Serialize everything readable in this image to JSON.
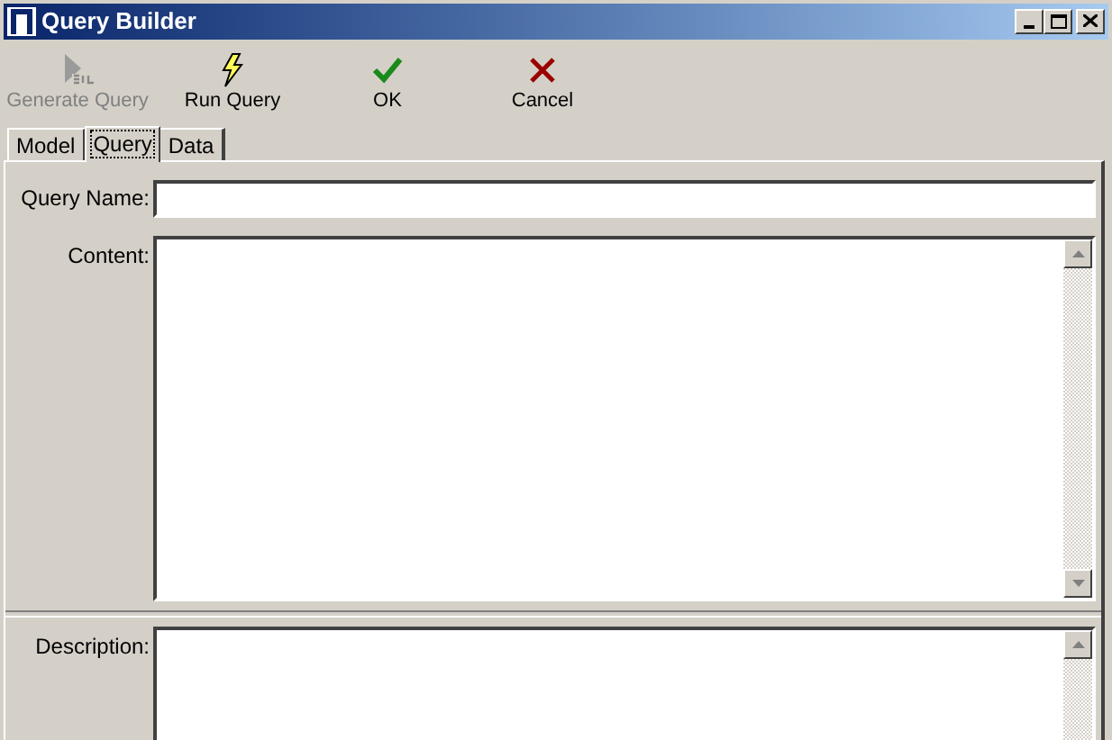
{
  "window": {
    "title": "Query Builder"
  },
  "toolbar": [
    {
      "label": "Generate Query",
      "kind": "generate",
      "disabled": true
    },
    {
      "label": "Run Query",
      "kind": "run",
      "disabled": false
    },
    {
      "label": "OK",
      "kind": "ok",
      "disabled": false
    },
    {
      "label": "Cancel",
      "kind": "cancel",
      "disabled": false
    }
  ],
  "tabs": [
    {
      "label": "Model",
      "selected": false
    },
    {
      "label": "Query",
      "selected": true
    },
    {
      "label": "Data",
      "selected": false
    }
  ],
  "fields": [
    {
      "label": "Query Name:",
      "kind": "line"
    },
    {
      "label": "Content:",
      "kind": "area"
    },
    {
      "label": "Description:",
      "kind": "area_cut"
    }
  ]
}
